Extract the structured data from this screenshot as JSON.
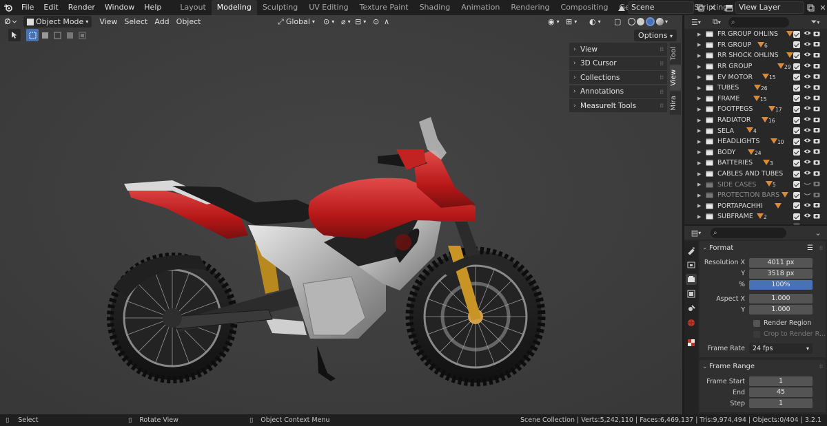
{
  "app": {
    "menus": [
      "File",
      "Edit",
      "Render",
      "Window",
      "Help"
    ],
    "workspace_tabs": [
      "Layout",
      "Modeling",
      "Sculpting",
      "UV Editing",
      "Texture Paint",
      "Shading",
      "Animation",
      "Rendering",
      "Compositing",
      "Geometry Nodes",
      "Scripting"
    ],
    "active_workspace": "Modeling",
    "scene": "Scene",
    "view_layer": "View Layer"
  },
  "viewport": {
    "mode": "Object Mode",
    "menus": [
      "View",
      "Select",
      "Add",
      "Object"
    ],
    "orientation": "Global",
    "options_label": "Options",
    "sidebar_panels": [
      "View",
      "3D Cursor",
      "Collections",
      "Annotations",
      "MeasureIt Tools"
    ],
    "sidebar_tabs": [
      "Tool",
      "View",
      "Mira"
    ],
    "active_sidebar_tab": "View"
  },
  "outliner": {
    "rows": [
      {
        "name": "FR GROUP OHLINS",
        "count": "",
        "dim": false
      },
      {
        "name": "FR GROUP",
        "count": "6",
        "dim": false
      },
      {
        "name": "RR SHOCK OHLINS",
        "count": "",
        "dim": false
      },
      {
        "name": "RR GROUP",
        "count": "29",
        "dim": false
      },
      {
        "name": "EV MOTOR",
        "count": "15",
        "dim": false
      },
      {
        "name": "TUBES",
        "count": "26",
        "dim": false
      },
      {
        "name": "FRAME",
        "count": "15",
        "dim": false
      },
      {
        "name": "FOOTPEGS",
        "count": "17",
        "dim": false
      },
      {
        "name": "RADIATOR",
        "count": "16",
        "dim": false
      },
      {
        "name": "SELA",
        "count": "4",
        "dim": false
      },
      {
        "name": "HEADLIGHTS",
        "count": "10",
        "dim": false
      },
      {
        "name": "BODY",
        "count": "24",
        "dim": false
      },
      {
        "name": "BATTERIES",
        "count": "3",
        "dim": false
      },
      {
        "name": "CABLES AND TUBES",
        "count": "",
        "dim": false
      },
      {
        "name": "SIDE CASES",
        "count": "5",
        "dim": true
      },
      {
        "name": "PROTECTION BARS",
        "count": "",
        "dim": true
      },
      {
        "name": "PORTAPACHHI",
        "count": "",
        "dim": false
      },
      {
        "name": "SUBFRAME",
        "count": "2",
        "dim": false
      },
      {
        "name": "TAILIGHT",
        "count": "",
        "dim": false
      }
    ]
  },
  "properties": {
    "format": {
      "title": "Format",
      "resolution_x_label": "Resolution X",
      "resolution_x": "4011 px",
      "resolution_y_label": "Y",
      "resolution_y": "3518 px",
      "percent_label": "%",
      "percent": "100%",
      "aspect_x_label": "Aspect X",
      "aspect_x": "1.000",
      "aspect_y_label": "Y",
      "aspect_y": "1.000",
      "render_region": "Render Region",
      "crop_to_render": "Crop to Render R...",
      "frame_rate_label": "Frame Rate",
      "frame_rate": "24 fps"
    },
    "frame_range": {
      "title": "Frame Range",
      "start_label": "Frame Start",
      "start": "1",
      "end_label": "End",
      "end": "45",
      "step_label": "Step",
      "step": "1"
    }
  },
  "statusbar": {
    "select": "Select",
    "rotate": "Rotate View",
    "context": "Object Context Menu",
    "stats": "Scene Collection | Verts:5,242,110 | Faces:6,469,137 | Tris:9,974,494 | Objects:0/404 | 3.2.1"
  },
  "colors": {
    "accent": "#4772b3",
    "viewport_bg": "#3d3d3d",
    "vertex_group_icon": "#d88a3a",
    "bike_red": "#c41f1f"
  }
}
